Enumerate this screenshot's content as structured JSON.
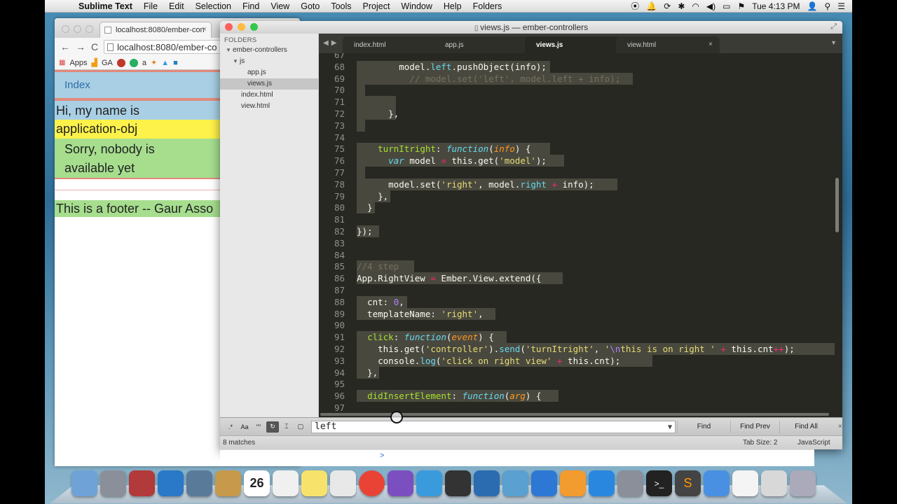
{
  "menubar": {
    "app": "Sublime Text",
    "items": [
      "File",
      "Edit",
      "Selection",
      "Find",
      "View",
      "Goto",
      "Tools",
      "Project",
      "Window",
      "Help",
      "Folders"
    ],
    "clock": "Tue 4:13 PM"
  },
  "browser": {
    "tab_title": "localhost:8080/ember-con",
    "url": "localhost:8080/ember-co",
    "bookmarks": [
      "Apps",
      "GA"
    ],
    "page": {
      "index_link": "Index",
      "greeting": "Hi, my name is",
      "name": "application-obj",
      "sorry_line1": "Sorry, nobody is",
      "sorry_line2": "available yet",
      "footer": "This is a footer -- Gaur Asso"
    }
  },
  "sublime": {
    "window_title": "views.js — ember-controllers",
    "sidebar": {
      "header": "FOLDERS",
      "root": "ember-controllers",
      "folder": "js",
      "files_js": [
        "app.js",
        "views.js"
      ],
      "files_root": [
        "index.html",
        "view.html"
      ],
      "selected": "views.js"
    },
    "tabs": [
      {
        "label": "index.html",
        "active": false
      },
      {
        "label": "app.js",
        "active": false
      },
      {
        "label": "views.js",
        "active": true
      },
      {
        "label": "view.html",
        "active": false
      }
    ],
    "gutter": [
      "67",
      "68",
      "69",
      "70",
      "71",
      "72",
      "73",
      "74",
      "75",
      "76",
      "77",
      "78",
      "79",
      "80",
      "81",
      "82",
      "83",
      "84",
      "85",
      "86",
      "87",
      "88",
      "89",
      "90",
      "91",
      "92",
      "93",
      "94",
      "95",
      "96",
      "97"
    ],
    "find": {
      "query": "left",
      "buttons": {
        "find": "Find",
        "find_prev": "Find Prev",
        "find_all": "Find All"
      },
      "options": [
        ".*",
        "Aa",
        "\"\""
      ]
    },
    "status": {
      "matches": "8 matches",
      "tab_size": "Tab Size: 2",
      "syntax": "JavaScript"
    }
  },
  "console": {
    "prompt": ">"
  },
  "dock": {
    "calendar_day": "26",
    "apps": [
      "finder-icon",
      "launchpad-icon",
      "photo-booth-icon",
      "safari-icon",
      "preview-icon",
      "contacts-icon",
      "calendar-icon",
      "reminders-icon",
      "stickies-icon",
      "preview-pdf-icon",
      "chrome-icon",
      "firefox-icon",
      "messages-icon",
      "facetime-icon",
      "photo-icon",
      "iphoto-icon",
      "itunes-icon",
      "ibooks-icon",
      "app-store-icon",
      "system-preferences-icon",
      "terminal-icon",
      "sublime-icon",
      "quicktime-icon",
      "document-icon",
      "finder-window-icon",
      "trash-icon"
    ]
  }
}
